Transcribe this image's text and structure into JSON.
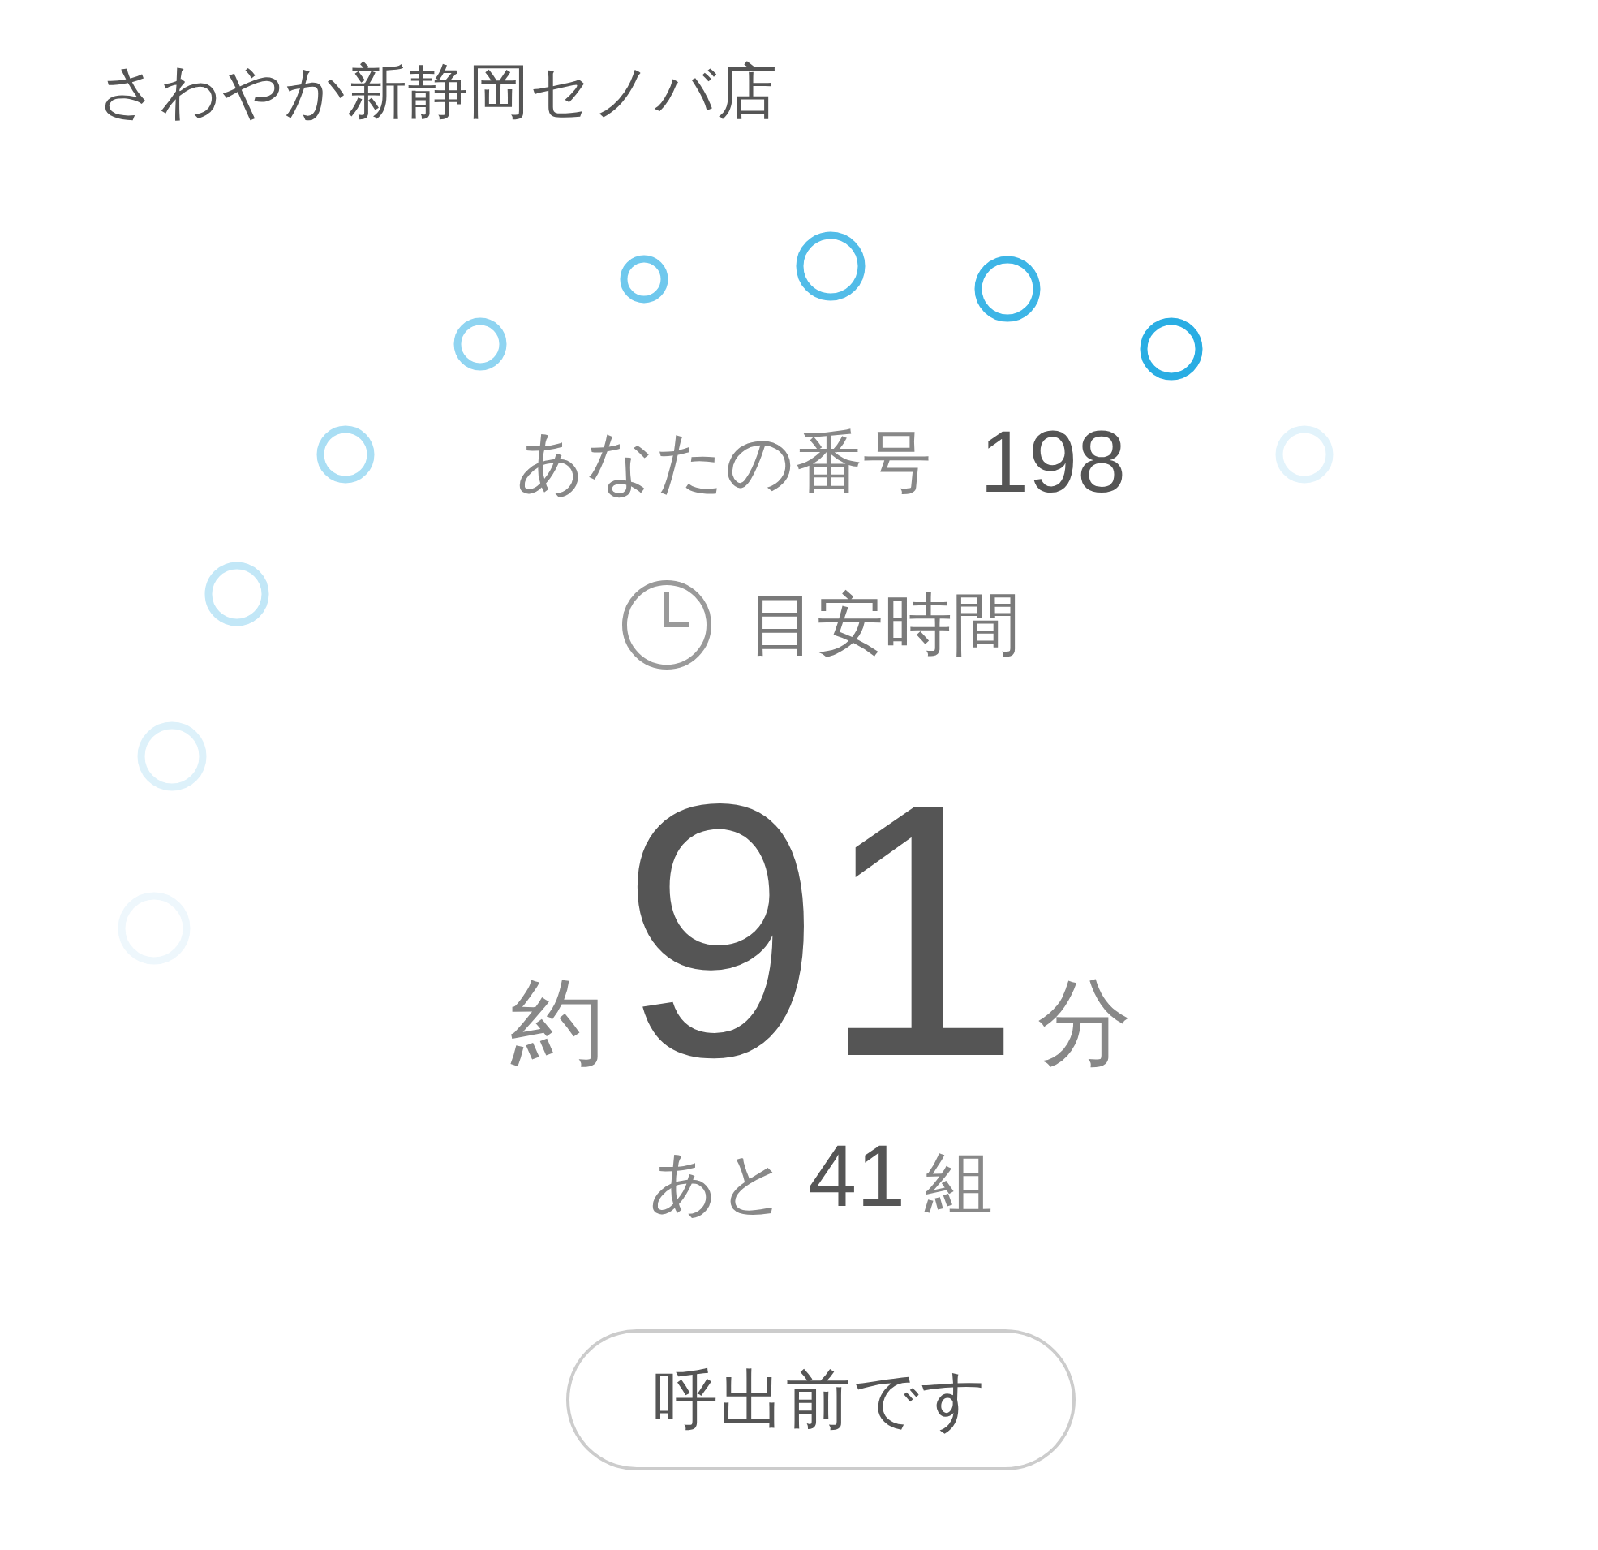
{
  "store_name": "さわやか新静岡セノバ店",
  "ticket": {
    "label": "あなたの番号",
    "number": "198"
  },
  "estimate": {
    "label": "目安時間",
    "prefix": "約",
    "minutes": "91",
    "unit": "分"
  },
  "queue": {
    "prefix": "あと",
    "count": "41",
    "unit": "組"
  },
  "status_button": {
    "label": "呼出前です"
  }
}
